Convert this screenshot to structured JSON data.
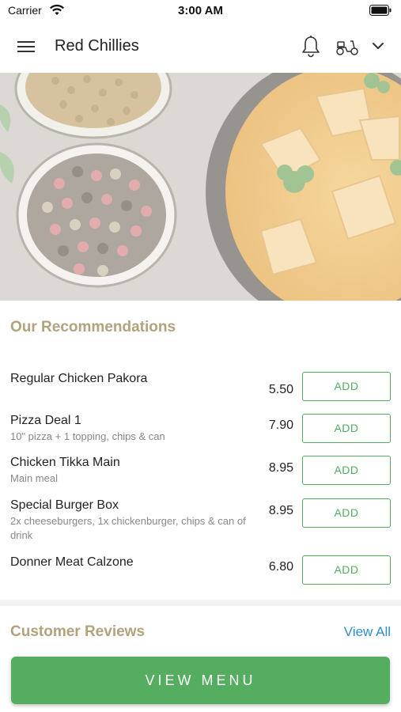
{
  "status_bar": {
    "carrier": "Carrier",
    "time": "3:00 AM"
  },
  "header": {
    "title": "Red Chillies",
    "icons": [
      "menu-icon",
      "bell-icon",
      "scooter-icon",
      "chevron-down-icon"
    ]
  },
  "hero": {
    "icon": "food-banner-image"
  },
  "recommendations": {
    "title": "Our Recommendations",
    "add_label": "ADD",
    "items": [
      {
        "name": "Regular Chicken Pakora",
        "description": "",
        "price": "5.50"
      },
      {
        "name": "Pizza Deal 1",
        "description": "10\" pizza + 1 topping, chips & can",
        "price": "7.90"
      },
      {
        "name": "Chicken Tikka Main",
        "description": "Main meal",
        "price": "8.95"
      },
      {
        "name": "Special Burger Box",
        "description": "2x cheeseburgers, 1x chickenburger, chips & can of drink",
        "price": "8.95"
      },
      {
        "name": "Donner Meat Calzone",
        "description": "",
        "price": "6.80"
      }
    ]
  },
  "reviews": {
    "title": "Customer Reviews",
    "view_all": "View All"
  },
  "footer": {
    "view_menu": "VIEW MENU"
  },
  "colors": {
    "accent_green": "#55ae5f",
    "section_title": "#b2a27d",
    "link_blue": "#2e8fd0"
  }
}
